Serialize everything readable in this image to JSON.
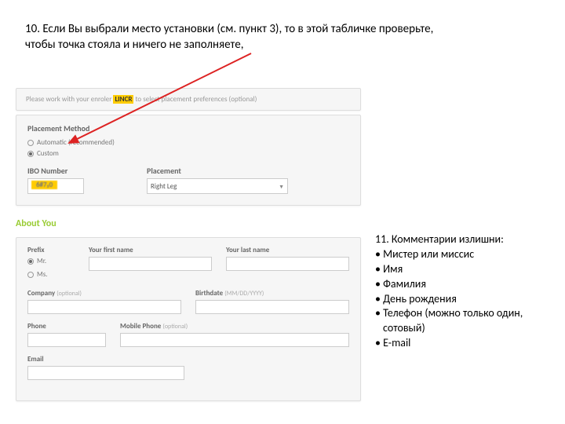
{
  "instruction_top": "10. Если Вы выбрали место установки (см. пункт 3), то в этой табличке проверьте, чтобы точка стояла и ничего не заполняете,",
  "panel1": {
    "pre": "Please work with your enroler",
    "highlight": "LINCR",
    "post": "to select placement preferences (optional)"
  },
  "panel2": {
    "section": "Placement Method",
    "option_auto": "Automatic (recommended)",
    "option_custom": "Custom",
    "ibo_label": "IBO Number",
    "ibo_value": "6#7₅0",
    "placement_label": "Placement",
    "placement_value": "Right Leg"
  },
  "about_you": "About You",
  "panel3": {
    "prefix": "Prefix",
    "prefix_mr": "Mr.",
    "prefix_ms": "Ms.",
    "first_name": "Your first name",
    "last_name": "Your last name",
    "company": "Company",
    "company_opt": "(optional)",
    "birthdate": "Birthdate",
    "birthdate_fmt": "(MM/DD/YYYY)",
    "phone": "Phone",
    "mobile": "Mobile Phone",
    "mobile_opt": "(optional)",
    "email": "Email"
  },
  "callout": {
    "title": "11. Комментарии излишни:",
    "items": [
      "Мистер или миссис",
      "Имя",
      "Фамилия",
      "День рождения",
      "Телефон (можно только один,",
      "   сотовый)",
      "E-mail"
    ]
  }
}
